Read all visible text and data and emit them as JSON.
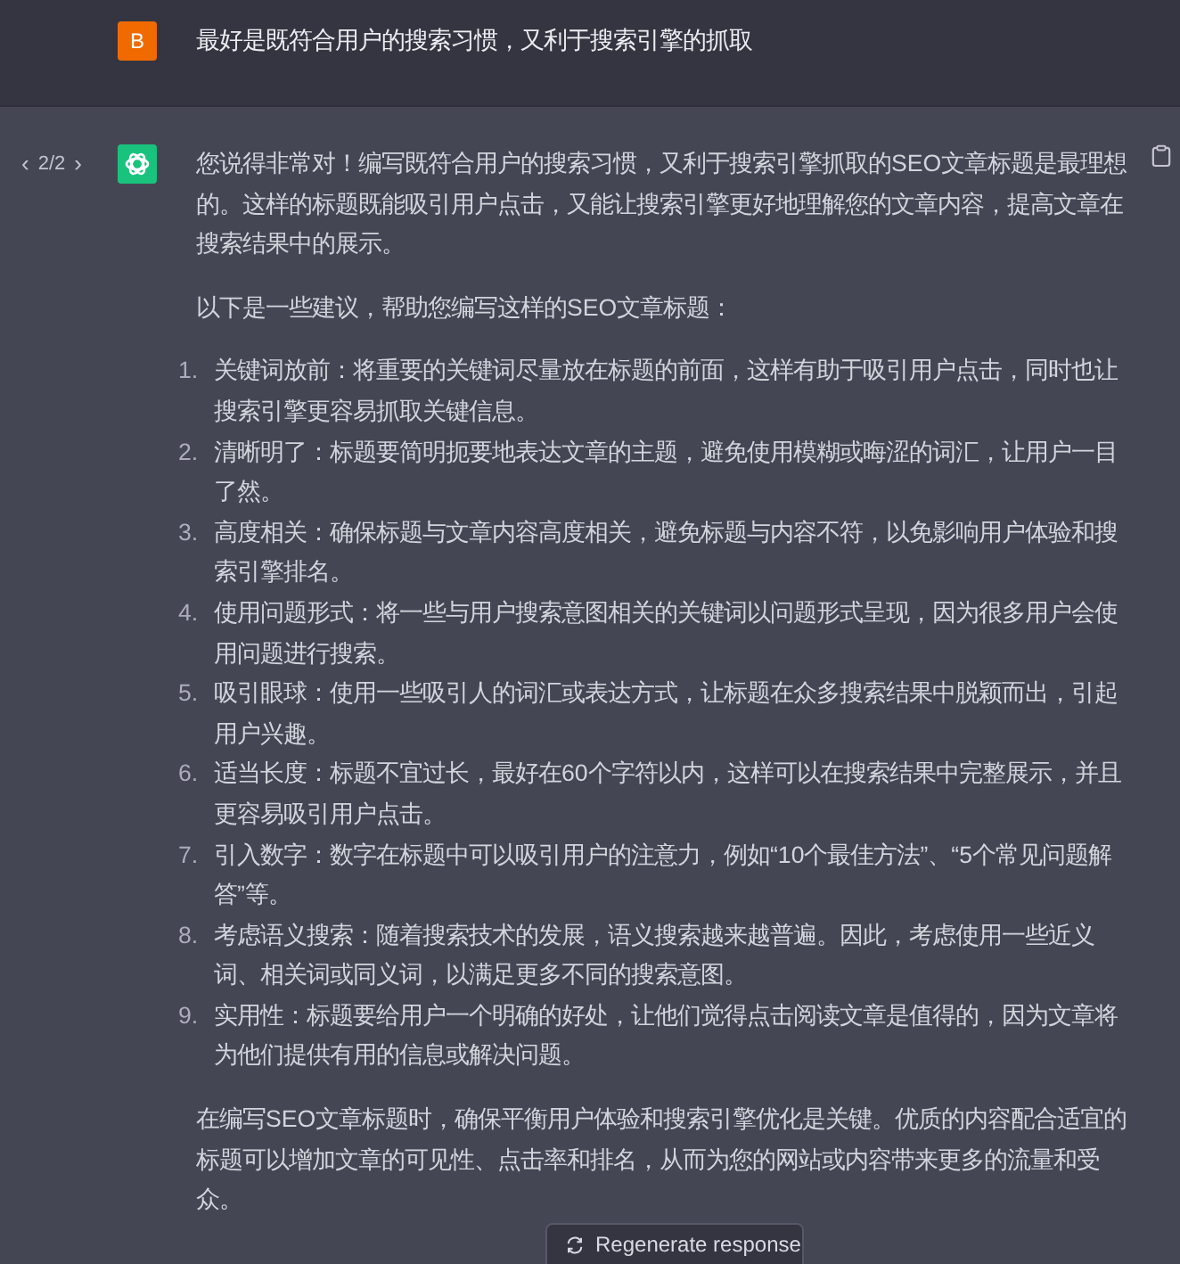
{
  "user_message": {
    "avatar": "B",
    "text": "最好是既符合用户的搜索习惯，又利于搜索引擎的抓取"
  },
  "assistant_message": {
    "pager": {
      "prev": "‹",
      "label": "2/2",
      "next": "›"
    },
    "intro": "您说得非常对！编写既符合用户的搜索习惯，又利于搜索引擎抓取的SEO文章标题是最理想的。这样的标题既能吸引用户点击，又能让搜索引擎更好地理解您的文章内容，提高文章在搜索结果中的展示。",
    "lead": "以下是一些建议，帮助您编写这样的SEO文章标题：",
    "items": [
      {
        "number": "1.",
        "text": "关键词放前：将重要的关键词尽量放在标题的前面，这样有助于吸引用户点击，同时也让搜索引擎更容易抓取关键信息。"
      },
      {
        "number": "2.",
        "text": "清晰明了：标题要简明扼要地表达文章的主题，避免使用模糊或晦涩的词汇，让用户一目了然。"
      },
      {
        "number": "3.",
        "text": "高度相关：确保标题与文章内容高度相关，避免标题与内容不符，以免影响用户体验和搜索引擎排名。"
      },
      {
        "number": "4.",
        "text": "使用问题形式：将一些与用户搜索意图相关的关键词以问题形式呈现，因为很多用户会使用问题进行搜索。"
      },
      {
        "number": "5.",
        "text": "吸引眼球：使用一些吸引人的词汇或表达方式，让标题在众多搜索结果中脱颖而出，引起用户兴趣。"
      },
      {
        "number": "6.",
        "text": "适当长度：标题不宜过长，最好在60个字符以内，这样可以在搜索结果中完整展示，并且更容易吸引用户点击。"
      },
      {
        "number": "7.",
        "text": "引入数字：数字在标题中可以吸引用户的注意力，例如“10个最佳方法”、“5个常见问题解答”等。"
      },
      {
        "number": "8.",
        "text": "考虑语义搜索：随着搜索技术的发展，语义搜索越来越普遍。因此，考虑使用一些近义词、相关词或同义词，以满足更多不同的搜索意图。"
      },
      {
        "number": "9.",
        "text": "实用性：标题要给用户一个明确的好处，让他们觉得点击阅读文章是值得的，因为文章将为他们提供有用的信息或解决问题。"
      }
    ],
    "conclusion": "在编写SEO文章标题时，确保平衡用户体验和搜索引擎优化是关键。优质的内容配合适宜的标题可以增加文章的可见性、点击率和排名，从而为您的网站或内容带来更多的流量和受众。"
  },
  "regenerate_button": "Regenerate response"
}
